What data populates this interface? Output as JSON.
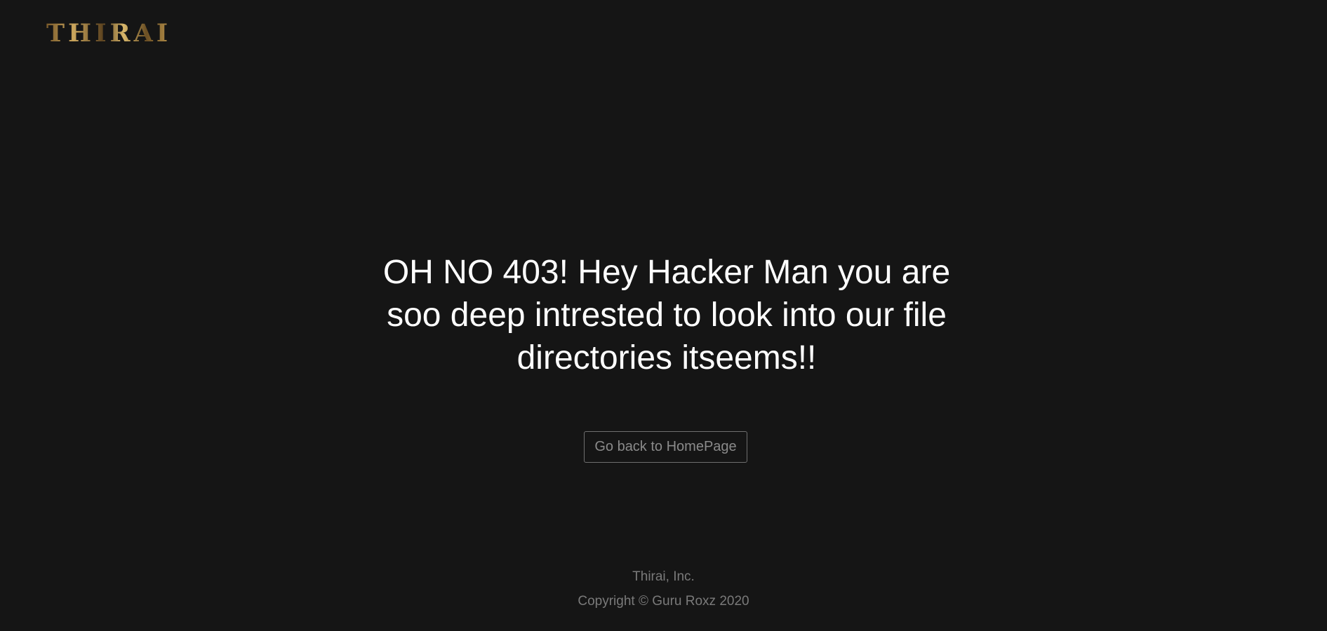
{
  "header": {
    "logo_text": "THIRAI"
  },
  "main": {
    "error_message": "OH NO 403! Hey Hacker Man you are soo deep intrested to look into our file directories itseems!!",
    "home_button_label": "Go back to HomePage"
  },
  "footer": {
    "company": "Thirai, Inc.",
    "copyright": "Copyright © Guru Roxz 2020"
  },
  "colors": {
    "background": "#151515",
    "logo_gold": "#c9a55c",
    "text_primary": "#ffffff",
    "text_muted": "#7a7a7a",
    "button_border": "#6f6f6f"
  }
}
